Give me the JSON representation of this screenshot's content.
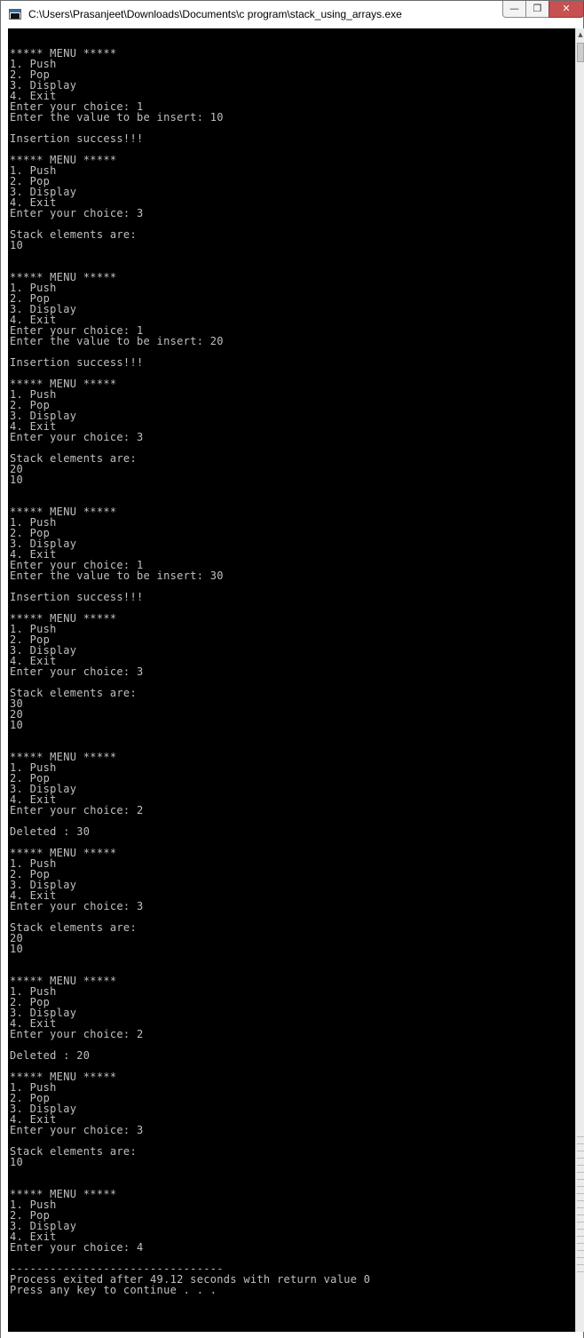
{
  "window": {
    "title": "C:\\Users\\Prasanjeet\\Downloads\\Documents\\c program\\stack_using_arrays.exe",
    "icon": "console-app-icon",
    "controls": {
      "minimize": "—",
      "maximize": "❐",
      "close": "✕"
    }
  },
  "console": {
    "background": "#000000",
    "foreground": "#c0c0c0",
    "output": "***** MENU *****\n1. Push\n2. Pop\n3. Display\n4. Exit\nEnter your choice: 1\nEnter the value to be insert: 10\n\nInsertion success!!!\n\n***** MENU *****\n1. Push\n2. Pop\n3. Display\n4. Exit\nEnter your choice: 3\n\nStack elements are:\n10\n\n\n***** MENU *****\n1. Push\n2. Pop\n3. Display\n4. Exit\nEnter your choice: 1\nEnter the value to be insert: 20\n\nInsertion success!!!\n\n***** MENU *****\n1. Push\n2. Pop\n3. Display\n4. Exit\nEnter your choice: 3\n\nStack elements are:\n20\n10\n\n\n***** MENU *****\n1. Push\n2. Pop\n3. Display\n4. Exit\nEnter your choice: 1\nEnter the value to be insert: 30\n\nInsertion success!!!\n\n***** MENU *****\n1. Push\n2. Pop\n3. Display\n4. Exit\nEnter your choice: 3\n\nStack elements are:\n30\n20\n10\n\n\n***** MENU *****\n1. Push\n2. Pop\n3. Display\n4. Exit\nEnter your choice: 2\n\nDeleted : 30\n\n***** MENU *****\n1. Push\n2. Pop\n3. Display\n4. Exit\nEnter your choice: 3\n\nStack elements are:\n20\n10\n\n\n***** MENU *****\n1. Push\n2. Pop\n3. Display\n4. Exit\nEnter your choice: 2\n\nDeleted : 20\n\n***** MENU *****\n1. Push\n2. Pop\n3. Display\n4. Exit\nEnter your choice: 3\n\nStack elements are:\n10\n\n\n***** MENU *****\n1. Push\n2. Pop\n3. Display\n4. Exit\nEnter your choice: 4\n\n--------------------------------\nProcess exited after 49.12 seconds with return value 0\nPress any key to continue . . ."
  },
  "scrollbar": {
    "up_arrow": "▲"
  }
}
